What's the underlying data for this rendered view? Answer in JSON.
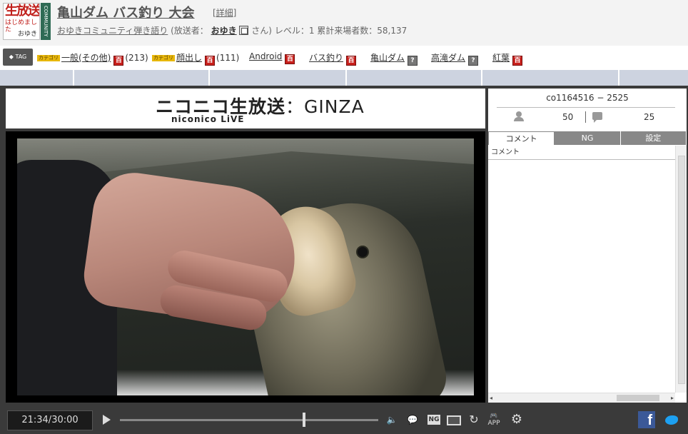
{
  "header": {
    "thumb_line1": "生放送",
    "thumb_line2": "はじめました",
    "thumb_line3": "おゆき",
    "community_band": "COMMUNITY",
    "title": "亀山ダム バス釣り 大会",
    "detail_link": "[詳細]",
    "community_name": "おゆきコミュニティ弾き語り",
    "broadcaster_prefix": "(放送者：",
    "broadcaster_name": "おゆき",
    "broadcaster_suffix": "さん)",
    "level_text": "レベル：1",
    "visitors_text": "累計来場者数：58,137"
  },
  "tagbar": {
    "tag_label": "TAG",
    "tags": [
      {
        "category": "カテゴリ",
        "name": "一般(その他)",
        "dict": "百",
        "count": "(213)"
      },
      {
        "category": "カテゴリ",
        "name": "顔出し",
        "dict": "百",
        "count": "(111)"
      },
      {
        "name": "Android",
        "dict": "百"
      },
      {
        "name": "バス釣り",
        "dict": "百"
      },
      {
        "name": "亀山ダム",
        "dict": "?"
      },
      {
        "name": "高滝ダム",
        "dict": "?"
      },
      {
        "name": "紅葉",
        "dict": "百"
      }
    ]
  },
  "player": {
    "logo_main": "ニコニコ生放送",
    "logo_ginza": "：GINZA",
    "logo_sub": "niconico LiVE"
  },
  "side": {
    "community_id": "co1164516 − 2525",
    "viewers": "50",
    "comments": "25",
    "tabs": [
      "コメント",
      "NG",
      "設定"
    ],
    "comment_header": "コメント"
  },
  "controls": {
    "time": "21:34/30:00",
    "ng_label": "NG",
    "app_label": "APP",
    "progress": 0.713
  },
  "colors": {
    "dict_red": "#c8201c",
    "tab_strip": "#cdd3e0",
    "player_bg": "#3a3a3a",
    "facebook": "#3b5998",
    "twitter": "#1da1f2"
  },
  "icons": [
    "tag-icon",
    "dictionary-icon",
    "person-icon",
    "comment-bubble-icon",
    "play-icon",
    "volume-icon",
    "comment-toggle-icon",
    "ng-icon",
    "screen-icon",
    "reload-icon",
    "app-icon",
    "gear-icon",
    "facebook-icon",
    "twitter-icon"
  ]
}
